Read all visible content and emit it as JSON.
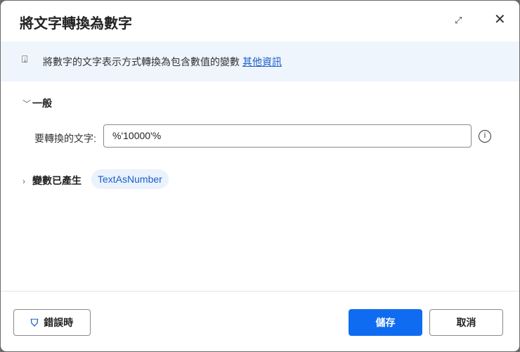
{
  "title": "將文字轉換為數字",
  "info": {
    "text": "將數字的文字表示方式轉換為包含數值的變數",
    "link": "其他資訊"
  },
  "general": {
    "heading": "一般",
    "field_label": "要轉換的文字:",
    "field_value": "%'10000'%"
  },
  "variables": {
    "heading": "變數已產生",
    "chip": "TextAsNumber"
  },
  "footer": {
    "on_error": "錯誤時",
    "save": "儲存",
    "cancel": "取消"
  }
}
